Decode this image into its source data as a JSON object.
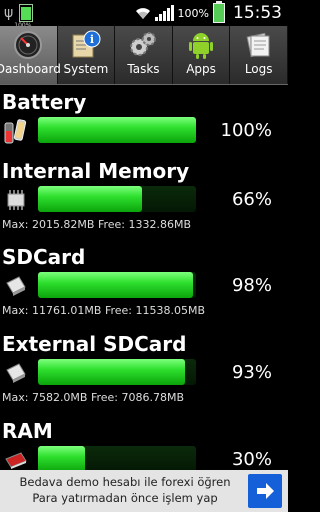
{
  "status_bar": {
    "battery_small_label": "100%",
    "battery_percent": "100%",
    "time": "15:53"
  },
  "tabs": [
    {
      "label": "Dashboard",
      "icon": "gauge-icon",
      "active": true
    },
    {
      "label": "System",
      "icon": "info-doc-icon",
      "active": false
    },
    {
      "label": "Tasks",
      "icon": "gears-icon",
      "active": false
    },
    {
      "label": "Apps",
      "icon": "android-icon",
      "active": false
    },
    {
      "label": "Logs",
      "icon": "papers-icon",
      "active": false
    }
  ],
  "sections": [
    {
      "title": "Battery",
      "icon": "battery-icon",
      "percent": "100%",
      "fill": 1.0,
      "info": ""
    },
    {
      "title": "Internal Memory",
      "icon": "chip-icon",
      "percent": "66%",
      "fill": 0.66,
      "info": "Max: 2015.82MB Free: 1332.86MB"
    },
    {
      "title": "SDCard",
      "icon": "sdcard-icon",
      "percent": "98%",
      "fill": 0.98,
      "info": "Max: 11761.01MB Free: 11538.05MB"
    },
    {
      "title": "External SDCard",
      "icon": "sdcard-icon",
      "percent": "93%",
      "fill": 0.93,
      "info": "Max: 7582.0MB Free: 7086.78MB"
    },
    {
      "title": "RAM",
      "icon": "ram-icon",
      "percent": "30%",
      "fill": 0.3,
      "info": ""
    }
  ],
  "ad": {
    "text": "Bedava demo hesabı ile forexi öğren Para yatırmadan önce işlem yap",
    "button_icon": "arrow-right-icon"
  },
  "colors": {
    "accent": "#2fe02f",
    "ad_button": "#1560d8"
  }
}
